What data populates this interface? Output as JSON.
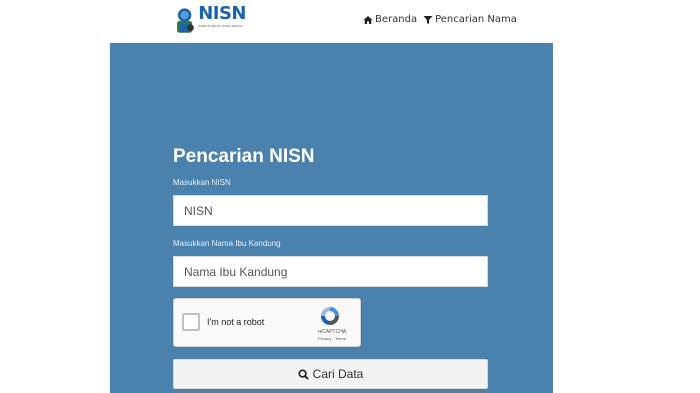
{
  "header": {
    "logo_title": "NISN",
    "logo_subtitle": "NOMOR INDUK SISWA NASIONAL",
    "nav": [
      {
        "label": "Beranda",
        "icon": "home-icon"
      },
      {
        "label": "Pencarian Nama",
        "icon": "filter-icon"
      }
    ]
  },
  "form": {
    "title": "Pencarian NISN",
    "nisn_label": "Masukkan NISN",
    "nisn_placeholder": "NISN",
    "mother_label": "Masukkan Nama Ibu Kandung",
    "mother_placeholder": "Nama Ibu Kandung",
    "captcha": {
      "label": "I'm not a robot",
      "brand": "reCAPTCHA",
      "terms": "Privacy - Terms"
    },
    "submit_label": "Cari Data",
    "submit_icon": "search-icon"
  },
  "colors": {
    "panel_bg": "#4a82ad",
    "logo_blue": "#1c63ad"
  }
}
